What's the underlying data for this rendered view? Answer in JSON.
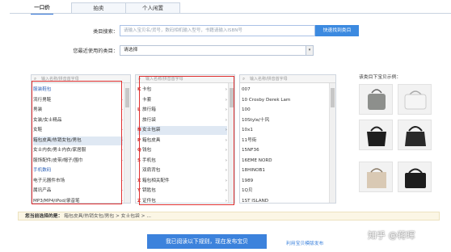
{
  "tabs": [
    "一口价",
    "拍卖",
    "个人闲置"
  ],
  "search": {
    "label": "类目搜索：",
    "placeholder": "请输入宝贝名/货号，数码相机输入型号，书籍请输入ISBN号",
    "button": "快速找到类目"
  },
  "recent": {
    "label": "您最近使用的类目：",
    "value": "请选择"
  },
  "col1": {
    "search_placeholder": "输入名称/拼音首字母",
    "items": [
      {
        "label": "服装鞋包",
        "group": true
      },
      {
        "label": "流行男鞋",
        "arrow": true
      },
      {
        "label": "男装",
        "arrow": true
      },
      {
        "label": "女装/女士精品",
        "arrow": true
      },
      {
        "label": "女鞋",
        "arrow": true
      },
      {
        "label": "箱包皮具/热销女包/男包",
        "arrow": true,
        "selected": true
      },
      {
        "label": "女士内衣/男士内衣/家居服",
        "arrow": true
      },
      {
        "label": "服饰配件/皮带/帽子/围巾",
        "arrow": true
      },
      {
        "label": "手机数码",
        "group": true
      },
      {
        "label": "电子元器件市场",
        "arrow": true
      },
      {
        "label": "属讯产品",
        "arrow": true
      },
      {
        "label": "MP3/MP4/iPod/录音笔",
        "arrow": true
      }
    ]
  },
  "col2": {
    "search_placeholder": "输入名称/拼音首字母",
    "items": [
      {
        "tag": "K",
        "label": "卡包",
        "arrow": true
      },
      {
        "tag": "",
        "label": "卡套",
        "arrow": true
      },
      {
        "tag": "L",
        "label": "旅行箱",
        "arrow": true
      },
      {
        "tag": "",
        "label": "旅行袋",
        "arrow": true
      },
      {
        "tag": "N",
        "label": "女士包袋",
        "arrow": true,
        "selected": true
      },
      {
        "tag": "P",
        "label": "箱包皮具",
        "arrow": true
      },
      {
        "tag": "Q",
        "label": "钱包",
        "arrow": true
      },
      {
        "tag": "S",
        "label": "手机包",
        "arrow": true
      },
      {
        "tag": "",
        "label": "双肩背包",
        "arrow": true
      },
      {
        "tag": "X",
        "label": "箱包相关配件",
        "arrow": true
      },
      {
        "tag": "Y",
        "label": "钥匙包",
        "arrow": true
      },
      {
        "tag": "Z",
        "label": "证件包",
        "arrow": true
      }
    ]
  },
  "col3": {
    "search_placeholder": "输入名称/拼音首字母",
    "items": [
      "007",
      "10 Crosby Derek Lam",
      "100",
      "10Style/十风",
      "10x1",
      "11号街",
      "15NF36",
      "16EME NORD",
      "18HINOB1",
      "1989",
      "1Q贝",
      "1ST ISLAND"
    ]
  },
  "examples_title": "该类目下宝贝示例：",
  "path": {
    "label": "您当前选择的是：",
    "value": "箱包皮具/热销女包/男包 > 女士包袋 > ..."
  },
  "submit": "我已阅读以下规则，现在发布宝贝",
  "template_link": "利用宝贝模版发布",
  "watermark": "知乎 @蒋晖"
}
